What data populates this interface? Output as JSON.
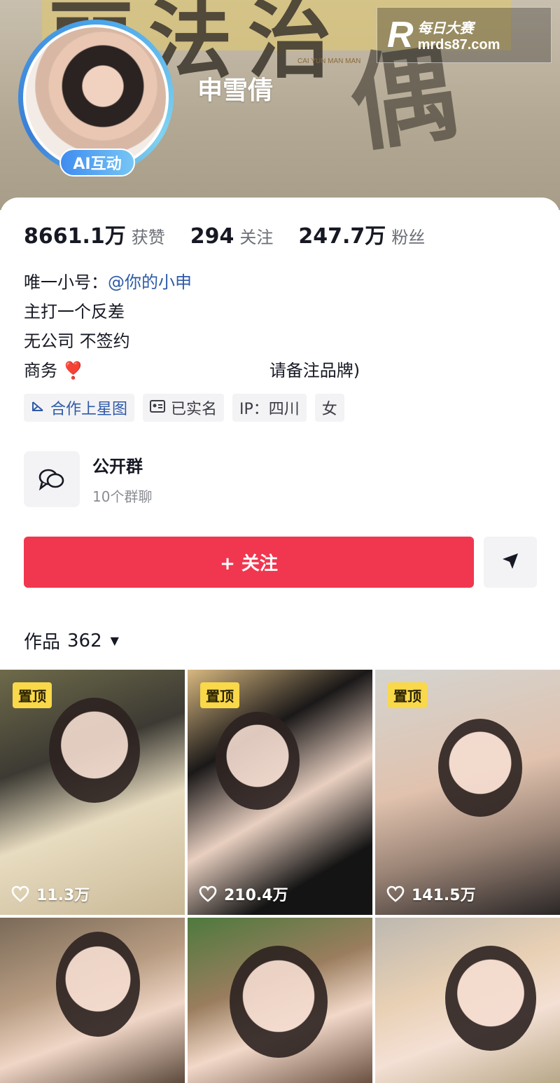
{
  "header": {
    "nickname": "申雪倩",
    "ai_badge": "AI互动",
    "art_subtitle": "CAI YUN MAN MAN",
    "watermark_line1": "每日大赛",
    "watermark_line2": "mrds87.com",
    "watermark_logo": "R"
  },
  "stats": {
    "likes_value": "8661.1万",
    "likes_label": "获赞",
    "following_value": "294",
    "following_label": "关注",
    "followers_value": "247.7万",
    "followers_label": "粉丝"
  },
  "bio": {
    "line1_prefix": "唯一小号：",
    "line1_mention": "@你的小申",
    "line2": "主打一个反差",
    "line3": "无公司 不签约",
    "line4_prefix": "商务",
    "line4_heart": "❣️",
    "line4_suffix": "请备注品牌)"
  },
  "tags": [
    {
      "label": "合作上星图",
      "icon": "star-map-icon"
    },
    {
      "label": "已实名",
      "icon": "id-card-icon"
    },
    {
      "label": "IP：四川",
      "icon": ""
    },
    {
      "label": "女",
      "icon": ""
    }
  ],
  "group": {
    "title": "公开群",
    "subtitle": "10个群聊",
    "icon": "chat-bubbles-icon"
  },
  "actions": {
    "follow_label": "+ 关注",
    "share_icon": "send-icon"
  },
  "works": {
    "label": "作品",
    "count": "362"
  },
  "videos": [
    {
      "pinned": "置顶",
      "likes": "11.3万"
    },
    {
      "pinned": "置顶",
      "likes": "210.4万"
    },
    {
      "pinned": "置顶",
      "likes": "141.5万"
    }
  ],
  "colors": {
    "follow_button": "#f1364f",
    "mention": "#2e5aa8",
    "pin_badge": "#f9d84a"
  }
}
